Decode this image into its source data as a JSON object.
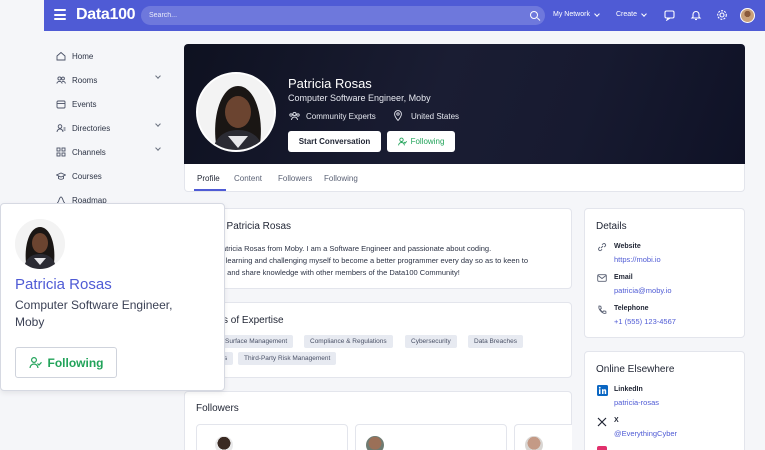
{
  "header": {
    "logo": "Data100",
    "search_placeholder": "Search...",
    "nav": [
      {
        "label": "My Network"
      },
      {
        "label": "Create"
      }
    ]
  },
  "sidebar": {
    "items": [
      {
        "label": "Home",
        "icon": "home-icon",
        "has_chevron": false
      },
      {
        "label": "Rooms",
        "icon": "people-icon",
        "has_chevron": true
      },
      {
        "label": "Events",
        "icon": "calendar-icon",
        "has_chevron": false
      },
      {
        "label": "Directories",
        "icon": "directory-icon",
        "has_chevron": true
      },
      {
        "label": "Channels",
        "icon": "grid-icon",
        "has_chevron": true
      },
      {
        "label": "Courses",
        "icon": "graduation-cap-icon",
        "has_chevron": false
      },
      {
        "label": "Roadmap",
        "icon": "roadmap-icon",
        "has_chevron": false
      }
    ]
  },
  "profile": {
    "name": "Patricia Rosas",
    "title": "Computer Software Engineer, Moby",
    "community": "Community Experts",
    "location": "United States",
    "start_conversation": "Start Conversation",
    "following": "Following"
  },
  "tabs": [
    "Profile",
    "Content",
    "Followers",
    "Following"
  ],
  "about": {
    "title": "About Patricia Rosas",
    "visible_title": "t Patricia Rosas",
    "lines": [
      "atricia Rosas from Moby. I am a Software Engineer and passionate about coding.",
      "ntly learning and challenging myself to become a better programmer every day so as to keen to",
      "t and share knowledge with other members of the Data100 Community!"
    ]
  },
  "expertise": {
    "visible_title": "s of Expertise",
    "tags": [
      "Surface Management",
      "Compliance & Regulations",
      "Cybersecurity",
      "Data Breaches",
      "s",
      "Third-Party Risk Management"
    ]
  },
  "followers": {
    "title": "Followers"
  },
  "details": {
    "title": "Details",
    "items": [
      {
        "label": "Website",
        "value": "https://mobi.io",
        "icon": "link-icon"
      },
      {
        "label": "Email",
        "value": "patricia@moby.io",
        "icon": "mail-icon"
      },
      {
        "label": "Telephone",
        "value": "+1 (555) 123-4567",
        "icon": "phone-icon"
      }
    ]
  },
  "elsewhere": {
    "title": "Online Elsewhere",
    "items": [
      {
        "label": "LinkedIn",
        "value": "patricia-rosas",
        "icon": "linkedin-icon"
      },
      {
        "label": "X",
        "value": "@EverythingCyber",
        "icon": "x-icon"
      }
    ]
  },
  "popup": {
    "name": "Patricia Rosas",
    "title": "Computer Software Engineer, Moby",
    "following": "Following"
  },
  "colors": {
    "brand": "#4f5bd5",
    "following_green": "#22a35a"
  }
}
